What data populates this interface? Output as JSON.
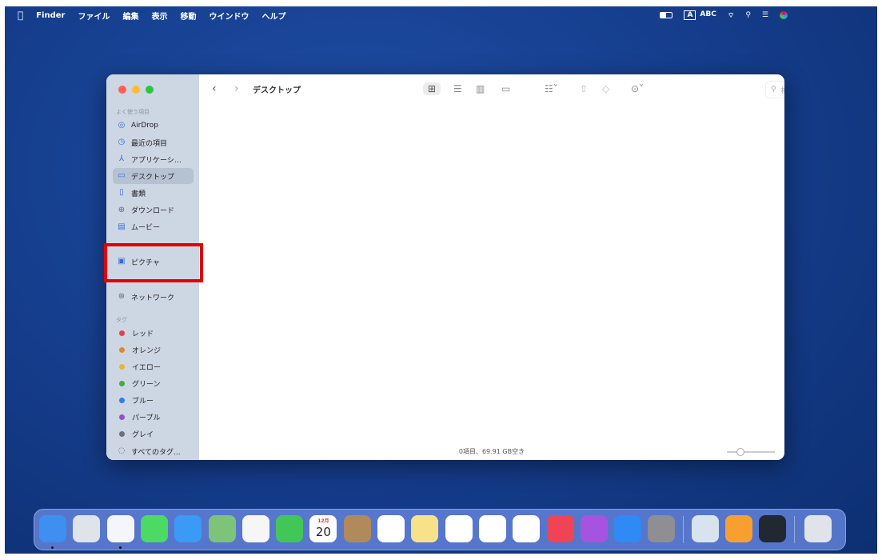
{
  "menubar": {
    "apple": "",
    "app": "Finder",
    "items": [
      "ファイル",
      "編集",
      "表示",
      "移動",
      "ウインドウ",
      "ヘルプ"
    ],
    "input_mode_a": "A",
    "input_mode": "ABC"
  },
  "window": {
    "title": "デスクトップ",
    "search_placeholder": "検索",
    "status": "0項目、69.91 GB空き",
    "sidebar": {
      "favorites_header": "よく使う項目",
      "favorites": [
        {
          "label": "AirDrop",
          "icon": "airdrop-icon"
        },
        {
          "label": "最近の項目",
          "icon": "clock-icon"
        },
        {
          "label": "アプリケーシ…",
          "icon": "applications-icon"
        },
        {
          "label": "デスクトップ",
          "icon": "desktop-icon",
          "selected": true
        },
        {
          "label": "書類",
          "icon": "document-icon"
        },
        {
          "label": "ダウンロード",
          "icon": "download-icon"
        },
        {
          "label": "ムービー",
          "icon": "movie-icon"
        },
        {
          "label": "ピクチャ",
          "icon": "picture-icon"
        }
      ],
      "network": "ネットワーク",
      "tags_header": "タグ",
      "tags": [
        {
          "label": "レッド",
          "color": "#e5404a"
        },
        {
          "label": "オレンジ",
          "color": "#e7832f"
        },
        {
          "label": "イエロー",
          "color": "#e6b535"
        },
        {
          "label": "グリーン",
          "color": "#47a848"
        },
        {
          "label": "ブルー",
          "color": "#2f7df0"
        },
        {
          "label": "パープル",
          "color": "#9450c8"
        },
        {
          "label": "グレイ",
          "color": "#6d7079"
        }
      ],
      "all_tags": "すべてのタグ..."
    }
  },
  "dock": {
    "apps": [
      {
        "name": "finder",
        "color": "#3d8ff0"
      },
      {
        "name": "launchpad",
        "color": "#dfe3ea"
      },
      {
        "name": "safari",
        "color": "#f4f6fa"
      },
      {
        "name": "messages",
        "color": "#4cd964"
      },
      {
        "name": "mail",
        "color": "#3a9af5"
      },
      {
        "name": "maps",
        "color": "#7dc47a"
      },
      {
        "name": "photos",
        "color": "#f6f6f6"
      },
      {
        "name": "facetime",
        "color": "#43c658"
      },
      {
        "name": "calendar",
        "color": "#ffffff",
        "month": "12月",
        "day": "20"
      },
      {
        "name": "contacts",
        "color": "#b08a5a"
      },
      {
        "name": "reminders",
        "color": "#ffffff"
      },
      {
        "name": "notes",
        "color": "#f7e28a"
      },
      {
        "name": "freeform",
        "color": "#ffffff"
      },
      {
        "name": "chrome",
        "color": "#ffffff"
      },
      {
        "name": "word",
        "color": "#ffffff"
      },
      {
        "name": "music",
        "color": "#f04455"
      },
      {
        "name": "podcasts",
        "color": "#a653e0"
      },
      {
        "name": "app-store",
        "color": "#2f8af5"
      },
      {
        "name": "system-settings",
        "color": "#8e8e93"
      }
    ],
    "extras": [
      {
        "name": "preview",
        "color": "#d9e3ef"
      },
      {
        "name": "pages",
        "color": "#f7a030"
      },
      {
        "name": "quicktime",
        "color": "#222831"
      }
    ],
    "trash": {
      "name": "trash",
      "color": "#e0e4ea"
    }
  }
}
